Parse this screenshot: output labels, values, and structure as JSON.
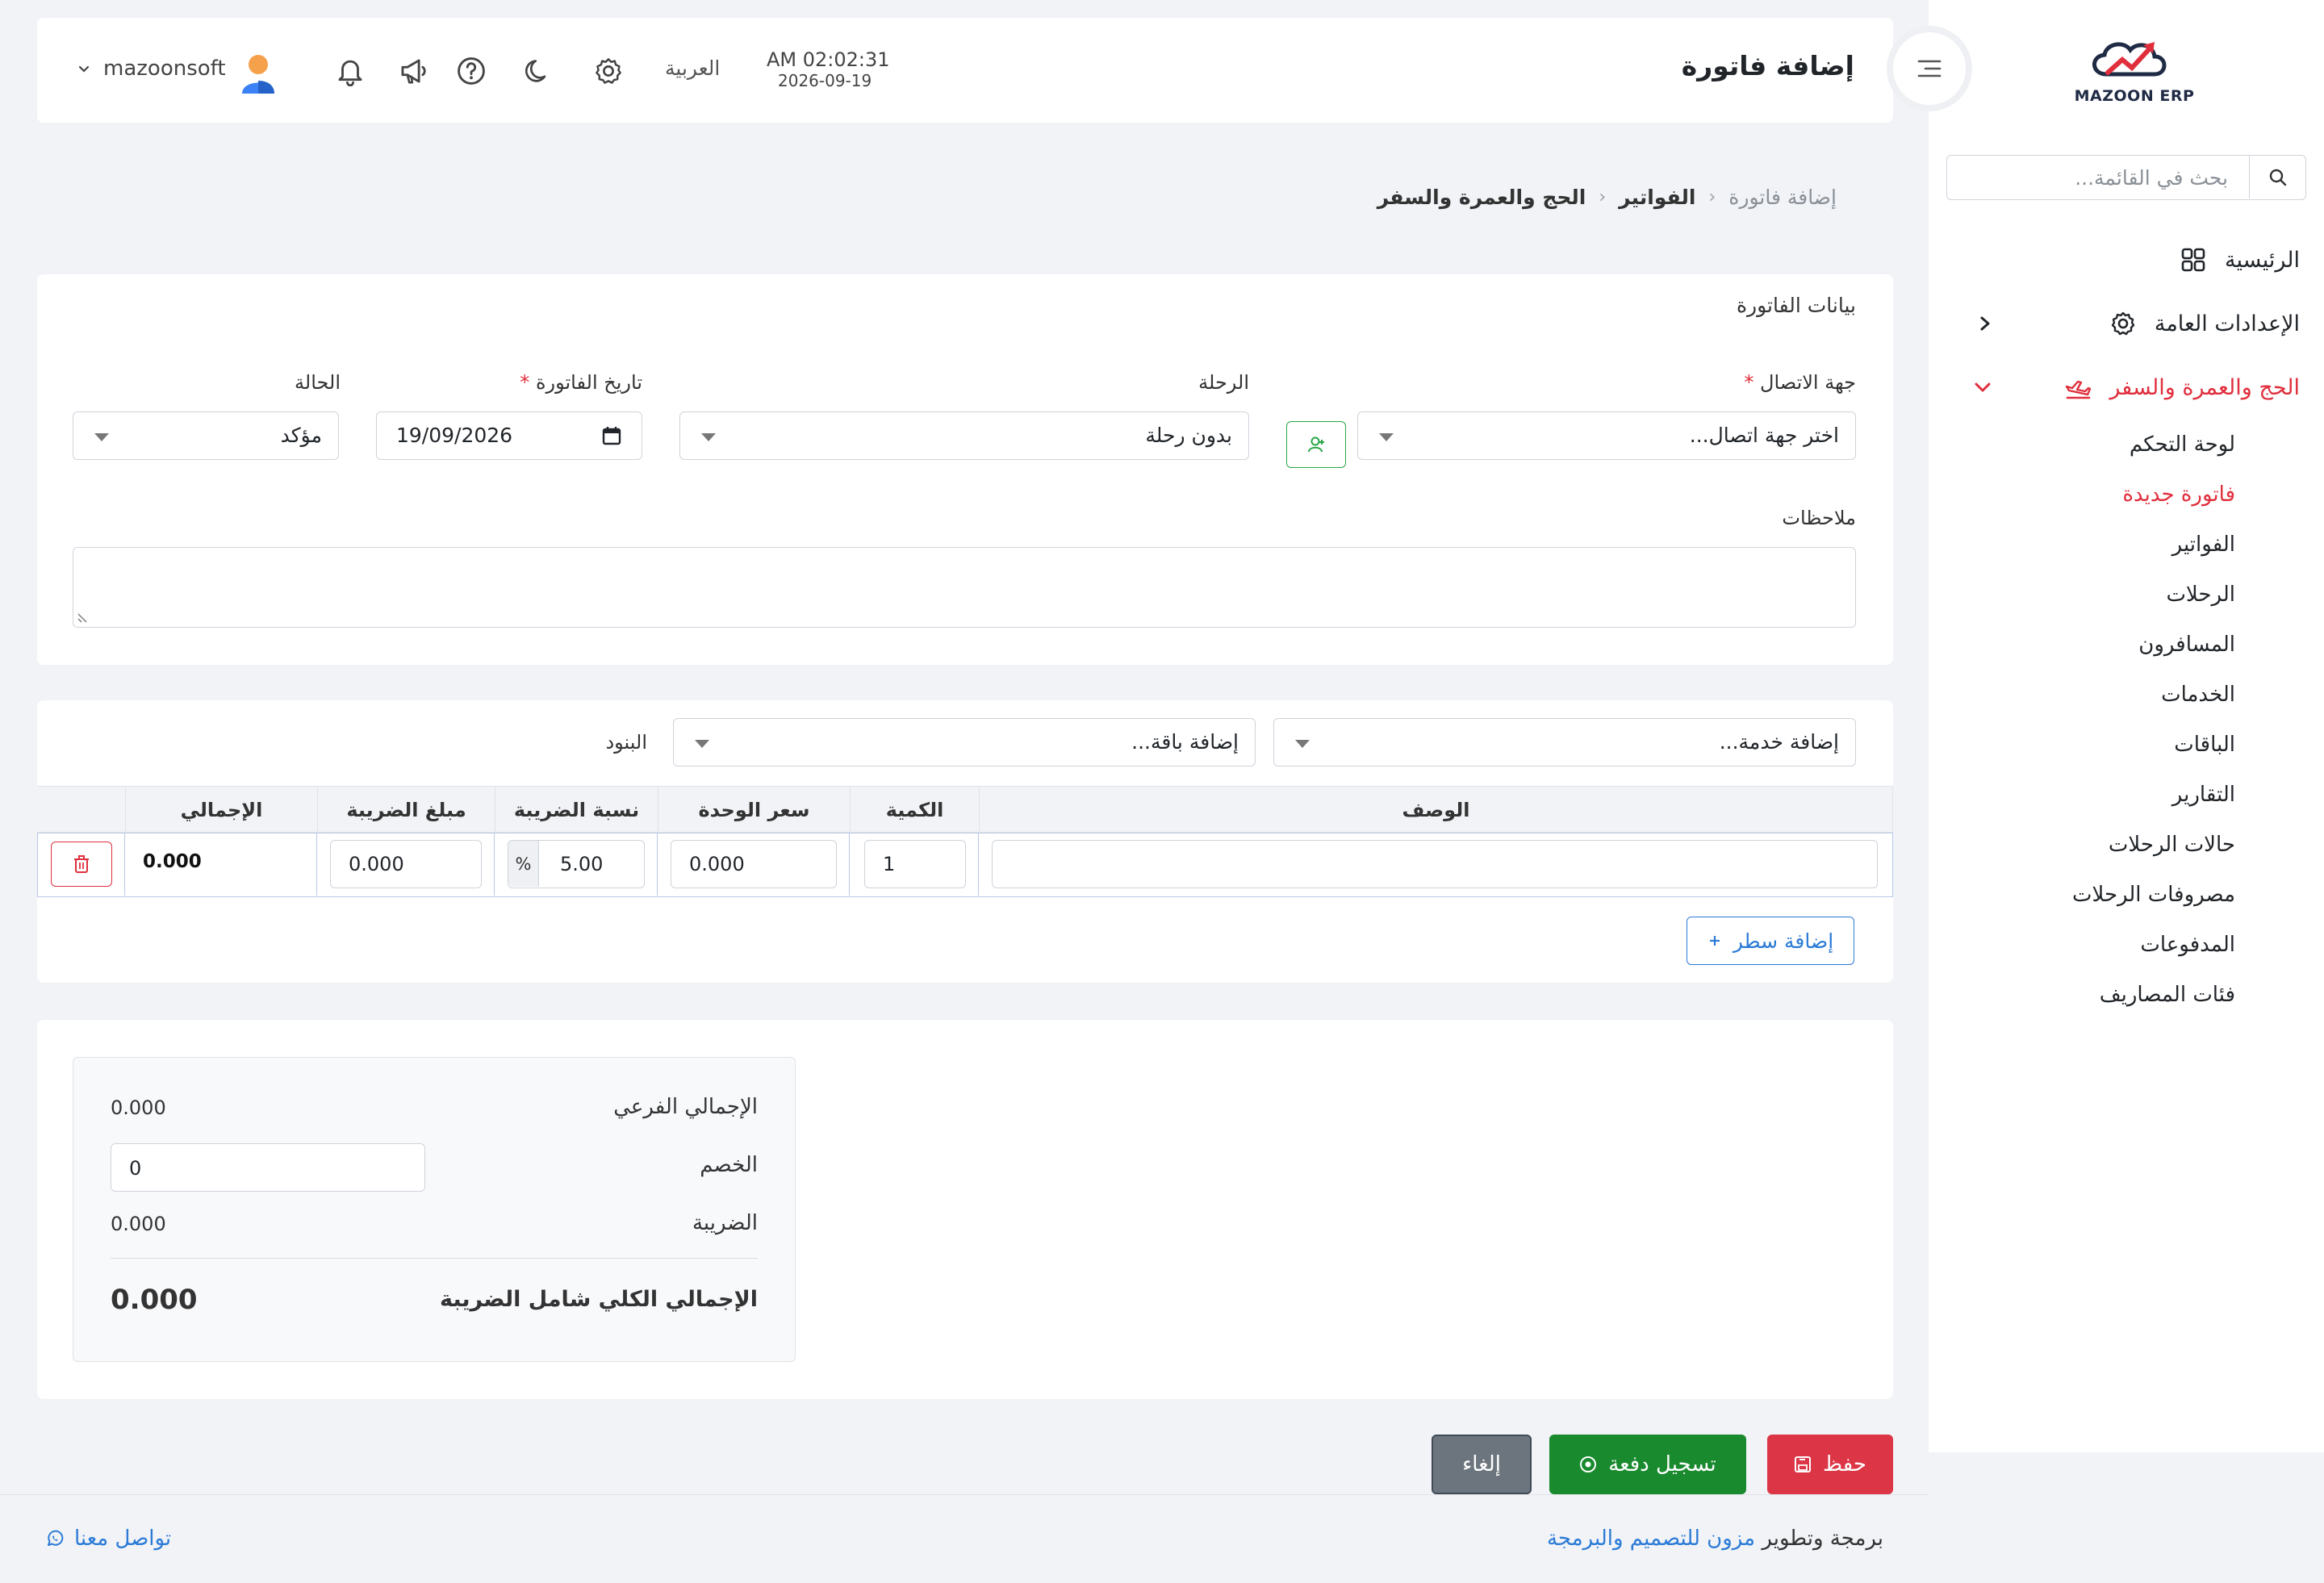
{
  "app": {
    "logo_text": "MAZOON ERP"
  },
  "sidebar": {
    "search_placeholder": "بحث في القائمة...",
    "items": [
      {
        "label": "الرئيسية",
        "icon": "grid-icon"
      },
      {
        "label": "الإعدادات العامة",
        "icon": "gear-icon"
      },
      {
        "label": "الحج والعمرة والسفر",
        "icon": "plane-icon",
        "active": true
      }
    ],
    "subitems": [
      {
        "label": "لوحة التحكم"
      },
      {
        "label": "فاتورة جديدة",
        "active": true
      },
      {
        "label": "الفواتير"
      },
      {
        "label": "الرحلات"
      },
      {
        "label": "المسافرون"
      },
      {
        "label": "الخدمات"
      },
      {
        "label": "الباقات"
      },
      {
        "label": "التقارير"
      },
      {
        "label": "حالات الرحلات"
      },
      {
        "label": "مصروفات الرحلات"
      },
      {
        "label": "المدفوعات"
      },
      {
        "label": "فئات المصاريف"
      }
    ]
  },
  "header": {
    "title": "إضافة فاتورة",
    "clock_time": "AM 02:02:31",
    "clock_date": "2026-09-19",
    "language": "العربية",
    "username": "mazoonsoft"
  },
  "breadcrumb": [
    "الحج والعمرة والسفر",
    "الفواتير",
    "إضافة فاتورة"
  ],
  "invoice_form": {
    "section_title": "بيانات الفاتورة",
    "contact_label": "جهة الاتصال",
    "contact_value": "اختر جهة اتصال...",
    "trip_label": "الرحلة",
    "trip_value": "بدون رحلة",
    "date_label": "تاريخ الفاتورة",
    "date_value": "19/09/2026",
    "status_label": "الحالة",
    "status_value": "مؤكد",
    "notes_label": "ملاحظات",
    "required_mark": "*"
  },
  "items": {
    "section_label": "البنود",
    "add_service_value": "إضافة خدمة...",
    "add_package_value": "إضافة باقة...",
    "columns": {
      "description": "الوصف",
      "quantity": "الكمية",
      "unit_price": "سعر الوحدة",
      "tax_rate": "نسبة الضريبة",
      "tax_amount": "مبلغ الضريبة",
      "total": "الإجمالي"
    },
    "rows": [
      {
        "description": "",
        "quantity": "1",
        "unit_price": "0.000",
        "tax_rate": "5.00",
        "tax_percent": "%",
        "tax_amount": "0.000",
        "total": "0.000"
      }
    ],
    "add_row_label": "إضافة سطر"
  },
  "totals": {
    "subtotal_label": "الإجمالي الفرعي",
    "subtotal_value": "0.000",
    "discount_label": "الخصم",
    "discount_value": "0",
    "tax_label": "الضريبة",
    "tax_value": "0.000",
    "grand_total_label": "الإجمالي الكلي شامل الضريبة",
    "grand_total_value": "0.000"
  },
  "actions": {
    "save_label": "حفظ",
    "record_payment_label": "تسجيل دفعة",
    "cancel_label": "إلغاء"
  },
  "footer": {
    "credit_prefix": "برمجة وتطوير",
    "credit_link": "مزون للتصميم والبرمجة",
    "contact_label": "تواصل معنا"
  },
  "colors": {
    "accent_red": "#e02e3c",
    "primary_blue": "#2b7bd6",
    "success_green": "#198a2e",
    "secondary_gray": "#6c757d"
  }
}
